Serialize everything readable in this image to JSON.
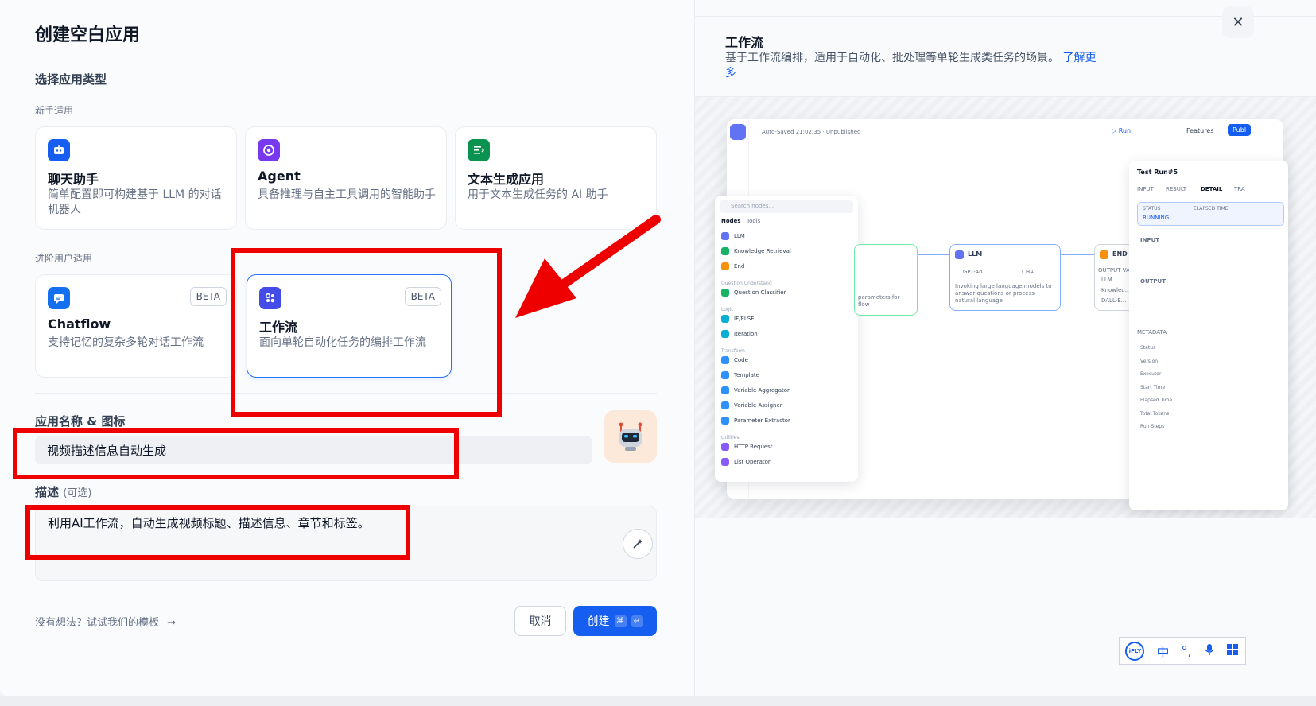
{
  "modal": {
    "title": "创建空白应用",
    "select_type_label": "选择应用类型",
    "beginner_label": "新手适用",
    "advanced_label": "进阶用户适用",
    "app_types_beginner": [
      {
        "name": "聊天助手",
        "desc": "简单配置即可构建基于 LLM 的对话机器人",
        "icon": "chat-bot-icon",
        "color": "#155eef"
      },
      {
        "name": "Agent",
        "desc": "具备推理与自主工具调用的智能助手",
        "icon": "agent-icon",
        "color": "#7839ee"
      },
      {
        "name": "文本生成应用",
        "desc": "用于文本生成任务的 AI 助手",
        "icon": "text-generate-icon",
        "color": "#099250"
      }
    ],
    "app_types_advanced": [
      {
        "name": "Chatflow",
        "desc": "支持记忆的复杂多轮对话工作流",
        "badge": "BETA",
        "icon": "chatflow-icon",
        "color": "#1570ef"
      },
      {
        "name": "工作流",
        "desc": "面向单轮自动化任务的编排工作流",
        "badge": "BETA",
        "icon": "workflow-icon",
        "color": "#444ce7",
        "selected": true
      }
    ],
    "name_label": "应用名称 & 图标",
    "name_value": "视频描述信息自动生成",
    "desc_label": "描述",
    "desc_optional": "(可选)",
    "desc_value": "利用AI工作流，自动生成视频标题、描述信息、章节和标签。",
    "template_hint": "没有想法？试试我们的模板",
    "cancel_label": "取消",
    "create_label": "创建",
    "create_kbd": [
      "⌘",
      "↵"
    ]
  },
  "preview": {
    "title": "工作流",
    "desc": "基于工作流编排，适用于自动化、批处理等单轮生成类任务的场景。",
    "learn_more": "了解更多",
    "close_icon": "close-icon",
    "mock": {
      "autosaved": "Auto-Saved 21:02:35 · Unpublished",
      "run": "▷ Run",
      "features": "Features",
      "publish": "Publ",
      "search_placeholder": "Search nodes...",
      "tabs": [
        "Nodes",
        "Tools"
      ],
      "node_list": [
        {
          "label": "LLM",
          "color": "#6172f3"
        },
        {
          "label": "Knowledge Retrieval",
          "color": "#16b364"
        },
        {
          "label": "End",
          "color": "#f79009"
        },
        {
          "label": "Question Understand",
          "group": true
        },
        {
          "label": "Question Classifier",
          "color": "#16b364"
        },
        {
          "label": "Logic",
          "group": true
        },
        {
          "label": "IF/ELSE",
          "color": "#06aed4"
        },
        {
          "label": "Iteration",
          "color": "#06aed4"
        },
        {
          "label": "Transform",
          "group": true
        },
        {
          "label": "Code",
          "color": "#2e90fa"
        },
        {
          "label": "Template",
          "color": "#2e90fa"
        },
        {
          "label": "Variable Aggregator",
          "color": "#2e90fa"
        },
        {
          "label": "Variable Assigner",
          "color": "#2e90fa"
        },
        {
          "label": "Parameter Extractor",
          "color": "#2e90fa"
        },
        {
          "label": "Utilities",
          "group": true
        },
        {
          "label": "HTTP Request",
          "color": "#875bf7"
        },
        {
          "label": "List Operator",
          "color": "#875bf7"
        }
      ],
      "llm_node": {
        "title": "LLM",
        "model": "GPT-4o",
        "mode": "CHAT",
        "desc": "Invoking large language models to answer questions or process natural language"
      },
      "end_node": {
        "title": "END",
        "output_label": "OUTPUT VARI...",
        "items": [
          "LLM",
          "Knowled...",
          "DALL-E..."
        ]
      },
      "start_node_text": "parameters for flow",
      "test_run": {
        "title": "Test Run#5",
        "tabs": [
          "INPUT",
          "RESULT",
          "DETAIL",
          "TRA"
        ],
        "status_label": "STATUS",
        "status_value": "RUNNING",
        "elapsed_label": "ELAPSED TIME",
        "input_label": "INPUT",
        "output_label": "OUTPUT",
        "metadata_label": "METADATA",
        "meta_rows": [
          "Status",
          "Version",
          "Executor",
          "Start Time",
          "Elapsed Time",
          "Total Tokens",
          "Run Steps"
        ]
      }
    }
  },
  "ime_bar": {
    "items": [
      "iFLY",
      "中",
      "°,",
      "mic",
      "grid"
    ]
  }
}
